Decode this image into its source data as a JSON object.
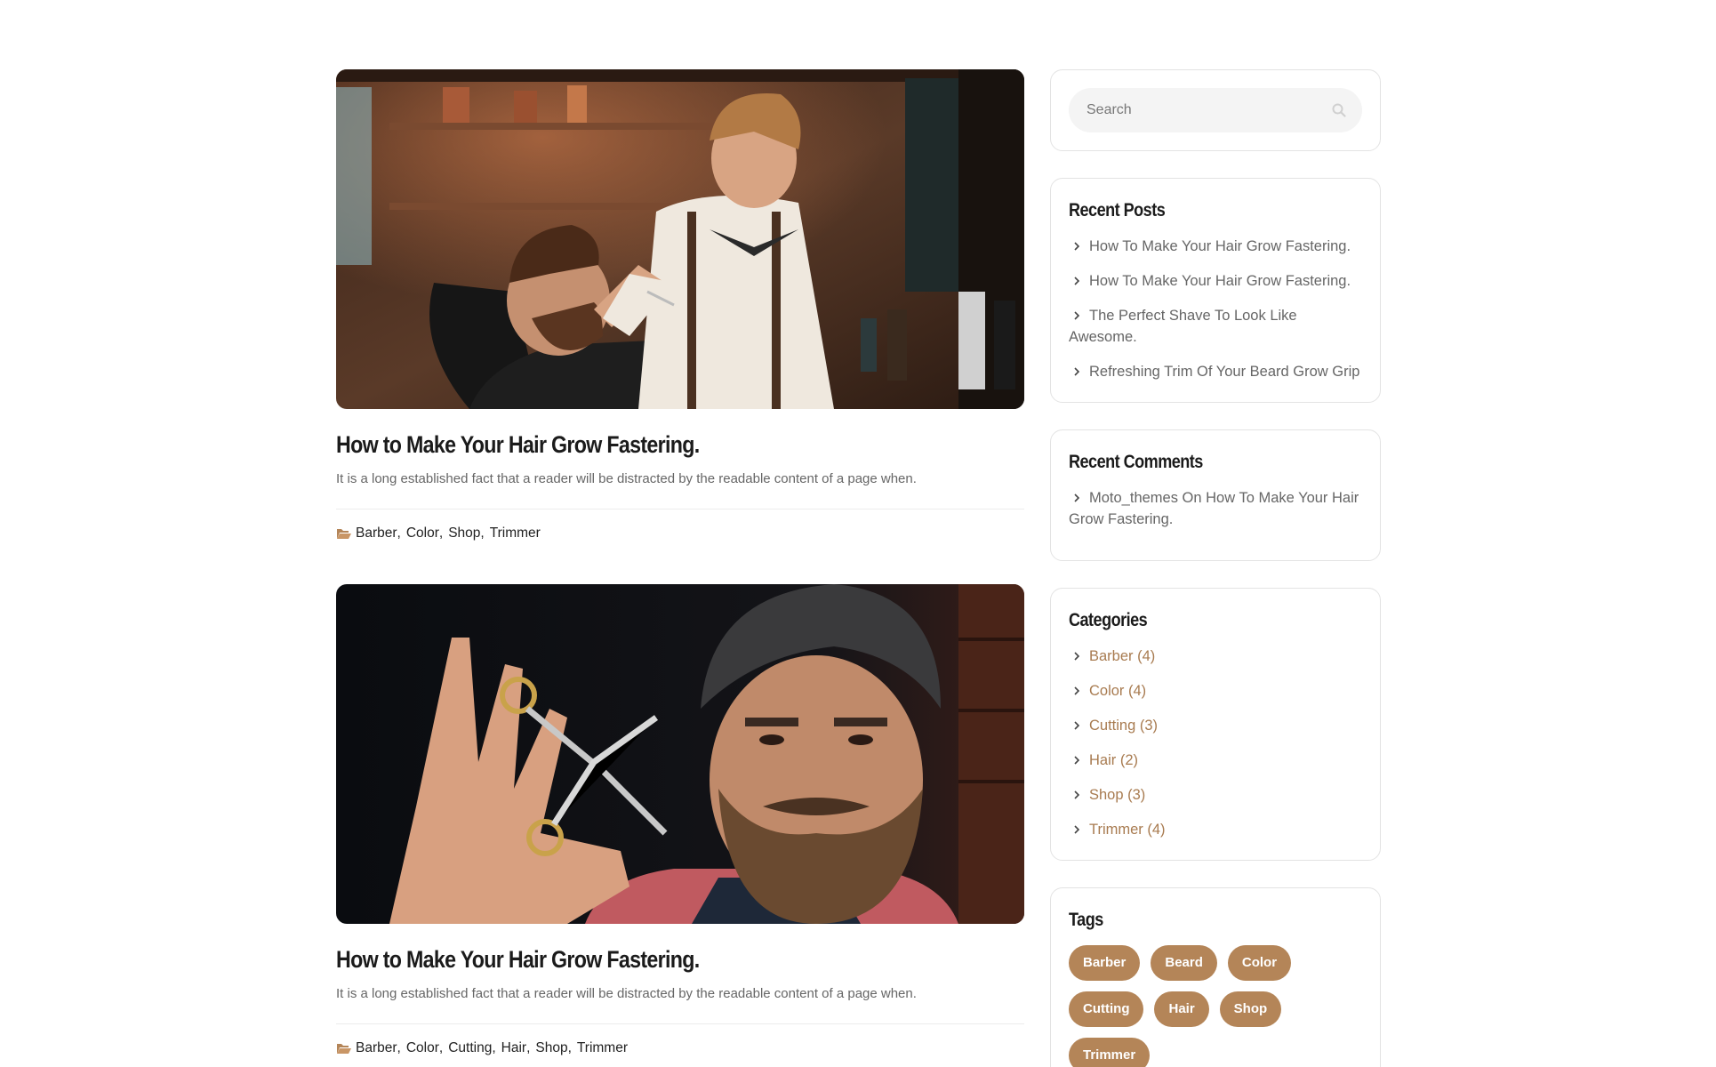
{
  "posts": [
    {
      "title": "How to Make Your Hair Grow Fastering.",
      "excerpt": "It is a long established fact that a reader will be distracted by the readable content of a page when.",
      "image": "barber-trimming-beard-photo",
      "categories": [
        "Barber",
        "Color",
        "Shop",
        "Trimmer"
      ]
    },
    {
      "title": "How to Make Your Hair Grow Fastering.",
      "excerpt": "It is a long established fact that a reader will be distracted by the readable content of a page when.",
      "image": "bearded-man-with-scissors-photo",
      "categories": [
        "Barber",
        "Color",
        "Cutting",
        "Hair",
        "Shop",
        "Trimmer"
      ]
    }
  ],
  "sidebar": {
    "search": {
      "placeholder": "Search",
      "icon": "search-icon"
    },
    "recent_posts": {
      "title": "Recent Posts",
      "items": [
        "How To Make Your Hair Grow Fastering.",
        "How To Make Your Hair Grow Fastering.",
        "The Perfect Shave To Look Like Awesome.",
        "Refreshing Trim Of Your Beard Grow Grip"
      ]
    },
    "recent_comments": {
      "title": "Recent Comments",
      "items": [
        "Moto_themes On How To Make Your Hair Grow Fastering."
      ]
    },
    "categories": {
      "title": "Categories",
      "items": [
        "Barber (4)",
        "Color (4)",
        "Cutting (3)",
        "Hair (2)",
        "Shop (3)",
        "Trimmer (4)"
      ]
    },
    "tags": {
      "title": "Tags",
      "items": [
        "Barber",
        "Beard",
        "Color",
        "Cutting",
        "Hair",
        "Shop",
        "Trimmer"
      ]
    }
  },
  "colors": {
    "accent": "#b48558",
    "category_link": "#a87b50",
    "heading": "#1b1b1b",
    "body_text": "#666666"
  }
}
